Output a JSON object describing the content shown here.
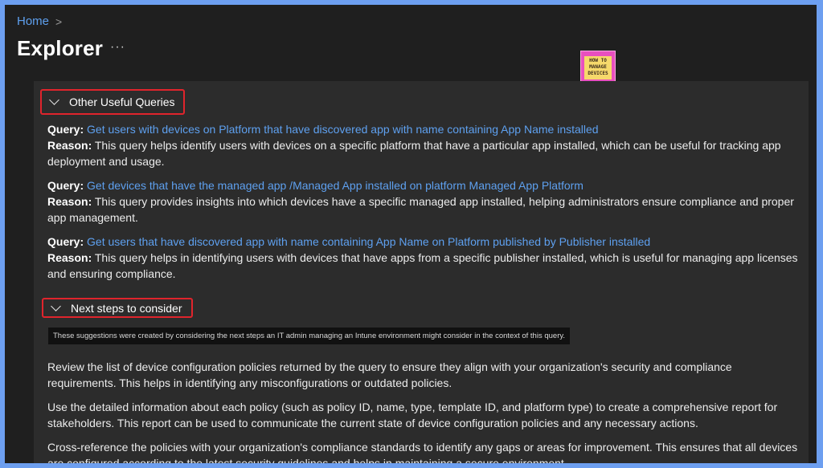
{
  "breadcrumb": {
    "home": "Home",
    "separator": ">"
  },
  "page": {
    "title": "Explorer",
    "more_label": "···"
  },
  "logo": {
    "line1": "HOW TO",
    "line2": "MANAGE",
    "line3": "DEVICES"
  },
  "sections": {
    "queries_header": "Other Useful Queries",
    "next_header": "Next steps to consider"
  },
  "labels": {
    "query": "Query:",
    "reason": "Reason:"
  },
  "queries": [
    {
      "link": "Get users with devices on Platform that have discovered app with name containing App Name installed",
      "reason": "This query helps identify users with devices on a specific platform that have a particular app installed, which can be useful for tracking app deployment and usage."
    },
    {
      "link": "Get devices that have the managed app /Managed App installed on platform Managed App Platform",
      "reason": "This query provides insights into which devices have a specific managed app installed, helping administrators ensure compliance and proper app management."
    },
    {
      "link": "Get users that have discovered app with name containing App Name on Platform published by Publisher installed",
      "reason": "This query helps in identifying users with devices that have apps from a specific publisher installed, which is useful for managing app licenses and ensuring compliance."
    }
  ],
  "tooltip": "These suggestions were created by considering the next steps an IT admin managing an Intune environment might consider in the context of this query.",
  "next_steps": [
    "Review the list of device configuration policies returned by the query to ensure they align with your organization's security and compliance requirements. This helps in identifying any misconfigurations or outdated policies.",
    "Use the detailed information about each policy (such as policy ID, name, type, template ID, and platform type) to create a comprehensive report for stakeholders. This report can be used to communicate the current state of device configuration policies and any necessary actions.",
    "Cross-reference the policies with your organization's compliance standards to identify any gaps or areas for improvement. This ensures that all devices are configured according to the latest security guidelines and helps in maintaining a secure environment."
  ]
}
